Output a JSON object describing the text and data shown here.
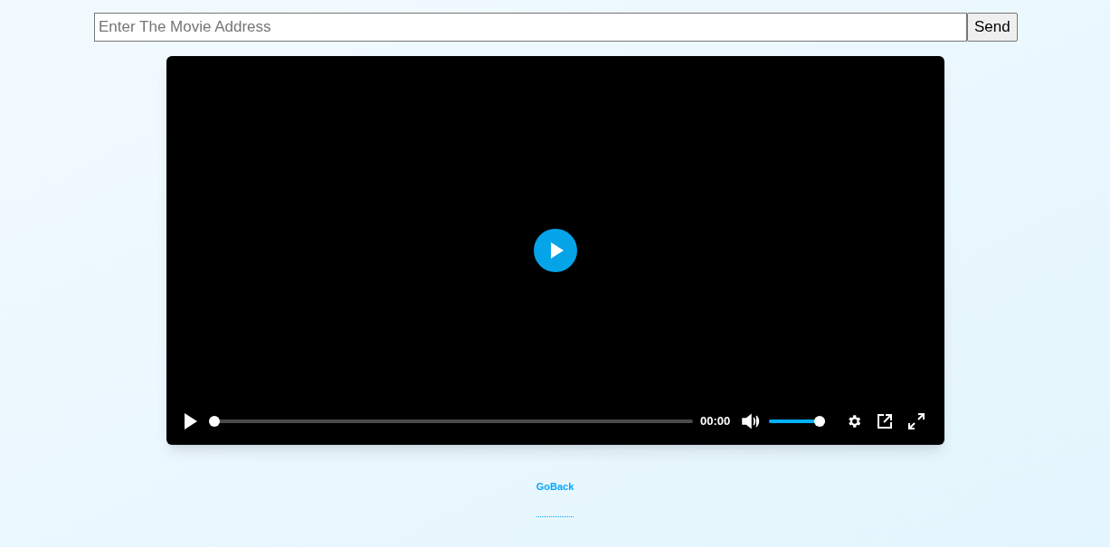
{
  "address_bar": {
    "placeholder": "Enter The Movie Address",
    "button": "Send"
  },
  "player": {
    "playing": false,
    "time": "00:00",
    "progress": {
      "level": 0
    },
    "volume": {
      "level": 1
    }
  },
  "link": "GoBack"
}
